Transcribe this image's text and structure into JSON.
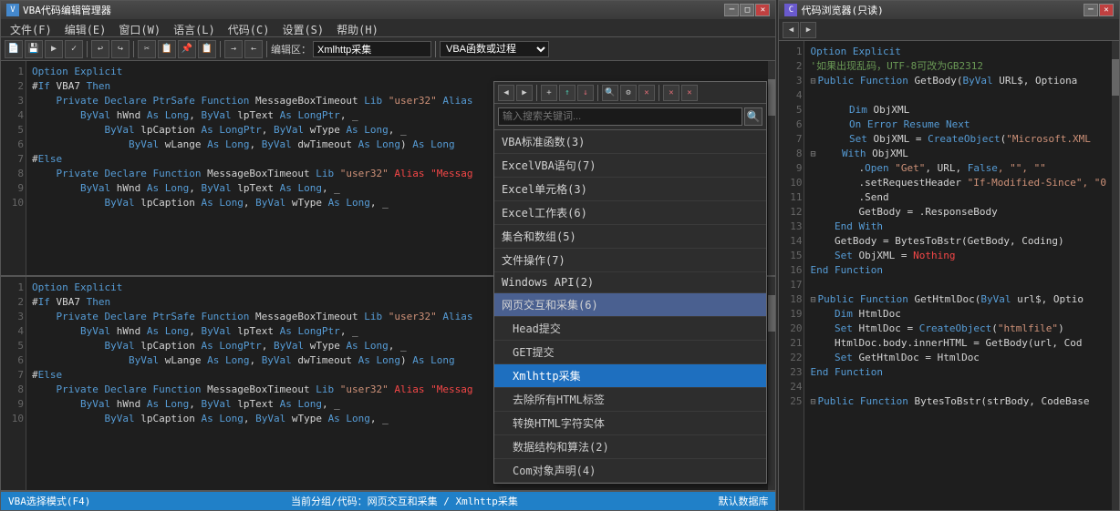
{
  "left_window": {
    "title": "VBA代码编辑管理器",
    "menu": [
      "文件(F)",
      "编辑(E)",
      "窗口(W)",
      "语言(L)",
      "代码(C)",
      "设置(S)",
      "帮助(H)"
    ],
    "toolbar": {
      "editor_label": "编辑区：",
      "editor_value": "Xmlhttp采集",
      "proc_placeholder": "VBA函数或过程"
    },
    "status": {
      "left": "VBA选择模式(F4)",
      "center": "当前分组/代码：网页交互和采集 / Xmlhttp采集",
      "right": "默认数据库"
    }
  },
  "code_panel_top": [
    {
      "ln": "1",
      "content": "Option Explicit"
    },
    {
      "ln": "2",
      "content": "#If VBA7 Then"
    },
    {
      "ln": "3",
      "content": "    Private Declare PtrSafe Function MessageBoxTimeout Lib \"user32\" Alias"
    },
    {
      "ln": "4",
      "content": "        ByVal hWnd As Long, ByVal lpText As LongPtr, _"
    },
    {
      "ln": "5",
      "content": "            ByVal lpCaption As LongPtr, ByVal wType As Long, _"
    },
    {
      "ln": "6",
      "content": "                ByVal wLange As Long, ByVal dwTimeout As Long) As Long"
    },
    {
      "ln": "7",
      "content": "#Else"
    },
    {
      "ln": "8",
      "content": "    Private Declare Function MessageBoxTimeout Lib \"user32\" Alias \"Messag"
    },
    {
      "ln": "9",
      "content": "        ByVal hWnd As Long, ByVal lpText As Long, _"
    },
    {
      "ln": "10",
      "content": "            ByVal lpCaption As Long, ByVal wType As Long, _"
    }
  ],
  "code_panel_bottom": [
    {
      "ln": "1",
      "content": "Option Explicit"
    },
    {
      "ln": "2",
      "content": "#If VBA7 Then"
    },
    {
      "ln": "3",
      "content": "    Private Declare PtrSafe Function MessageBoxTimeout Lib \"user32\" Alias"
    },
    {
      "ln": "4",
      "content": "        ByVal hWnd As Long, ByVal lpText As LongPtr, _"
    },
    {
      "ln": "5",
      "content": "            ByVal lpCaption As LongPtr, ByVal wType As Long, _"
    },
    {
      "ln": "6",
      "content": "                ByVal wLange As Long, ByVal dwTimeout As Long) As Long"
    },
    {
      "ln": "7",
      "content": "#Else"
    },
    {
      "ln": "8",
      "content": "    Private Declare Function MessageBoxTimeout Lib \"user32\" Alias \"Messag"
    },
    {
      "ln": "9",
      "content": "        ByVal hWnd As Long, ByVal lpText As Long, _"
    },
    {
      "ln": "10",
      "content": "            ByVal lpCaption As Long, ByVal wType As Long, _"
    }
  ],
  "dropdown": {
    "search_placeholder": "输入搜索关键词...",
    "items": [
      {
        "label": "VBA标准函数(3)",
        "type": "group"
      },
      {
        "label": "ExcelVBA语句(7)",
        "type": "group"
      },
      {
        "label": "Excel单元格(3)",
        "type": "group"
      },
      {
        "label": "Excel工作表(6)",
        "type": "group"
      },
      {
        "label": "集合和数组(5)",
        "type": "group"
      },
      {
        "label": "文件操作(7)",
        "type": "group"
      },
      {
        "label": "Windows API(2)",
        "type": "group"
      },
      {
        "label": "网页交互和采集(6)",
        "type": "group-active"
      },
      {
        "label": "Head提交",
        "type": "sub"
      },
      {
        "label": "GET提交",
        "type": "sub"
      },
      {
        "label": "Xmlhttp采集",
        "type": "sub-selected"
      },
      {
        "label": "去除所有HTML标签",
        "type": "sub"
      },
      {
        "label": "转换HTML字符实体",
        "type": "sub"
      },
      {
        "label": "数据结构和算法(2)",
        "type": "sub"
      },
      {
        "label": "Com对象声明(4)",
        "type": "sub"
      }
    ]
  },
  "right_window": {
    "title": "代码浏览器(只读)",
    "code_lines": [
      {
        "ln": "1",
        "text": "Option Explicit"
      },
      {
        "ln": "2",
        "text": "'如果出现乱码，UTF-8可改为GB2312"
      },
      {
        "ln": "3",
        "text": "Public Function GetBody(ByVal URL$, Optiona",
        "fold": true
      },
      {
        "ln": "4",
        "text": ""
      },
      {
        "ln": "5",
        "text": "    Dim ObjXML"
      },
      {
        "ln": "6",
        "text": "    On Error Resume Next"
      },
      {
        "ln": "7",
        "text": "    Set ObjXML = CreateObject(\"Microsoft.XML"
      },
      {
        "ln": "8",
        "text": "    With ObjXML",
        "fold": true
      },
      {
        "ln": "9",
        "text": "        .Open \"Get\", URL, False, \"\", \"\""
      },
      {
        "ln": "10",
        "text": "        .setRequestHeader \"If-Modified-Since\", \"0"
      },
      {
        "ln": "11",
        "text": "        .Send"
      },
      {
        "ln": "12",
        "text": "        GetBody = .ResponseBody"
      },
      {
        "ln": "13",
        "text": "    End With"
      },
      {
        "ln": "14",
        "text": "    GetBody = BytesToBstr(GetBody, Coding)"
      },
      {
        "ln": "15",
        "text": "    Set ObjXML = Nothing"
      },
      {
        "ln": "16",
        "text": "End Function"
      },
      {
        "ln": "17",
        "text": ""
      },
      {
        "ln": "18",
        "text": "Public Function GetHtmlDoc(ByVal url$, Optio",
        "fold": true
      },
      {
        "ln": "19",
        "text": "    Dim HtmlDoc"
      },
      {
        "ln": "20",
        "text": "    Set HtmlDoc = CreateObject(\"htmlfile\")"
      },
      {
        "ln": "21",
        "text": "    HtmlDoc.body.innerHTML = GetBody(url, Cod"
      },
      {
        "ln": "22",
        "text": "    Set GetHtmlDoc = HtmlDoc"
      },
      {
        "ln": "23",
        "text": "End Function"
      },
      {
        "ln": "24",
        "text": ""
      },
      {
        "ln": "25",
        "text": "Public Function BytesToBstr(strBody, CodeBase",
        "fold": true
      }
    ]
  }
}
